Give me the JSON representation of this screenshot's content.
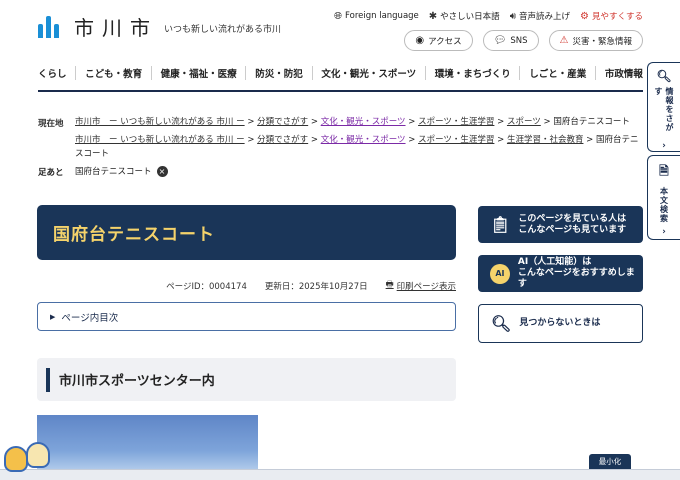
{
  "header": {
    "logo_text": "市川市",
    "tagline": "いつも新しい流れがある市川",
    "utility": [
      {
        "icon": "globe-icon",
        "label": "Foreign language"
      },
      {
        "icon": "easy-japanese-icon",
        "label": "やさしい日本語"
      },
      {
        "icon": "speaker-icon",
        "label": "音声読み上げ"
      },
      {
        "icon": "gear-icon",
        "label": "見やすくする"
      }
    ],
    "pills": [
      {
        "icon": "location-pin-icon",
        "label": "アクセス"
      },
      {
        "icon": "chat-bubble-icon",
        "label": "SNS"
      },
      {
        "icon": "alert-icon",
        "label": "災害・緊急情報"
      }
    ]
  },
  "nav": [
    "くらし",
    "こども・教育",
    "健康・福祉・医療",
    "防災・防犯",
    "文化・観光・スポーツ",
    "環境・まちづくり",
    "しごと・産業",
    "市政情報"
  ],
  "breadcrumb": {
    "label": "現在地",
    "trail1": [
      "市川市　ー いつも新しい流れがある 市川 ー",
      "分類でさがす",
      "文化・観光・スポーツ",
      "スポーツ・生涯学習",
      "スポーツ",
      "国府台テニスコート"
    ],
    "trail2": [
      "市川市　ー いつも新しい流れがある 市川 ー",
      "分類でさがす",
      "文化・観光・スポーツ",
      "スポーツ・生涯学習",
      "生涯学習・社会教育",
      "国府台テニスコート"
    ],
    "separator": ">"
  },
  "ashiato": {
    "label": "足あと",
    "item": "国府台テニスコート",
    "close": "×"
  },
  "page": {
    "title": "国府台テニスコート",
    "page_id": "ページID：0004174",
    "updated": "更新日：2025年10月27日",
    "print": "印刷ページ表示",
    "toc": "ページ内目次",
    "section_heading": "市川市スポーツセンター内"
  },
  "side": {
    "viewed": "このページを見ている人は\nこんなページも見ています",
    "ai_badge": "AI",
    "ai": "AI（人工知能）は\nこんなページをおすすめします",
    "notfound": "見つからないときは"
  },
  "rail": [
    {
      "icon": "search-icon",
      "label": "情報をさがす"
    },
    {
      "icon": "document-search-icon",
      "label": "本文検索"
    }
  ],
  "minimize": "最小化",
  "colors": {
    "navy": "#1a3558",
    "accent_yellow": "#f5d36b",
    "link_purple": "#7b2aa6",
    "alert_red": "#d0342c"
  }
}
